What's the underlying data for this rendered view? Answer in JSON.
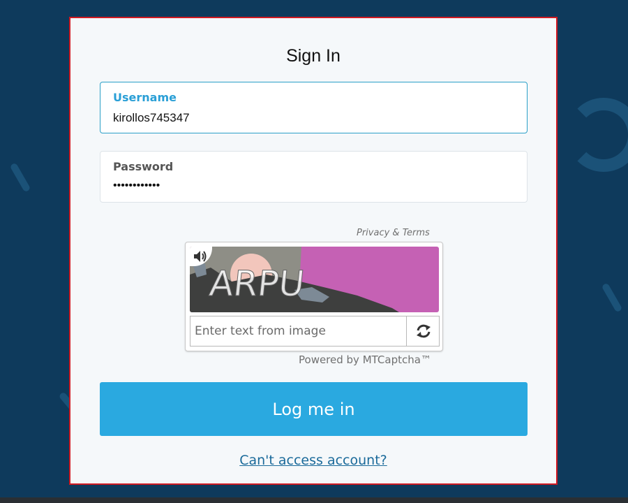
{
  "page": {
    "title": "Sign In"
  },
  "form": {
    "username": {
      "label": "Username",
      "value": "kirollos745347"
    },
    "password": {
      "label": "Password",
      "value": "••••••••••••"
    }
  },
  "captcha": {
    "privacy_link": "Privacy & Terms",
    "image_text": "ARPU",
    "input_placeholder": "Enter text from image",
    "input_value": "",
    "powered_by": "Powered by MTCaptcha™",
    "audio_icon": "speaker-icon",
    "refresh_icon": "refresh-icon"
  },
  "actions": {
    "login_label": "Log me in",
    "forgot_label": "Can't access account?"
  },
  "colors": {
    "background": "#0e3a5c",
    "card": "#f5f8fa",
    "card_border": "#d01a22",
    "accent": "#2aa9e0",
    "active_label": "#2a9fd6",
    "link": "#1a6a9a"
  }
}
